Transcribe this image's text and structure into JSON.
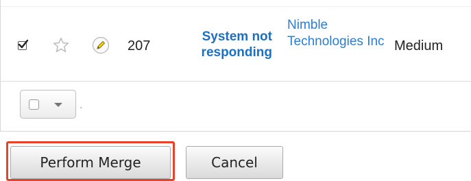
{
  "record": {
    "selected": true,
    "number": "207",
    "subject": "System not responding",
    "account": "Nimble Technologies Inc",
    "priority": "Medium"
  },
  "icons": {
    "checkbox": "checkmark-icon",
    "favorite": "star-icon",
    "edit": "pencil-icon",
    "mass_select": "chevron-down-icon"
  },
  "footer": {
    "separator": "."
  },
  "actions": {
    "perform_merge_label": "Perform Merge",
    "cancel_label": "Cancel"
  },
  "colors": {
    "link": "#2e7ccf",
    "highlight": "#e8432a"
  }
}
